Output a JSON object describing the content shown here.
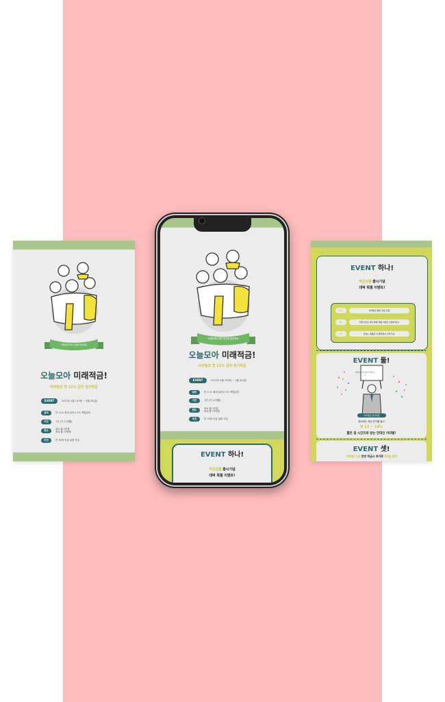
{
  "promo": {
    "banner": "가평안에 더해 가입해 빛내세요",
    "title_teal": "오늘모아",
    "title_dark": "미래적금!",
    "subtitle": "이라벌코 연 11% 금리 정기적금",
    "event_label": "EVENT",
    "event_text": "2023년 4월 15(목) ~ 4월 30(일)",
    "details": [
      {
        "label": "금리",
        "text": "연 11% 최대 금리시 5% 적립금리"
      },
      {
        "label": "기간",
        "text": "1년 (가 12개월)"
      },
      {
        "label": "한도",
        "text": "최소 월 1만원\n최대 월 70만원"
      },
      {
        "label": "조건",
        "text": "연 18세 이상 실명 가입"
      }
    ]
  },
  "event1": {
    "title_teal": "EVENT",
    "title_dark": "하나!",
    "line1_yellow": "적금상품",
    "line1_dark": "출시기념",
    "line2": "대박 특별 이벤트!",
    "items": [
      {
        "label": "하나!",
        "text": "이라벌코 통장 개설 전원"
      },
      {
        "label": "둘!",
        "text": "적금가입한 계좌 특별 경품 이벤트 이용하세요!"
      },
      {
        "label": "셋!",
        "text": "친하는 경품은 내 통장에서 선착가능!"
      }
    ]
  },
  "event2": {
    "title_teal": "EVENT",
    "title_dark": "둘!",
    "sign_text": "이라벌코 정기적금 최대 금리",
    "badge": "이라벌코 정기적금",
    "line1": "최소에는 적금 만기를 들고",
    "rate": "연 12 ~ 14%",
    "line2": "짧은 길 시간으로 받는 만대인 이라벌!"
  },
  "event3": {
    "title_teal": "EVENT",
    "title_dark": "셋!",
    "line_prefix": "70만원 이상",
    "line_dark": "한번 적금시 추가로",
    "line_suffix": "5만원 증정"
  },
  "colors": {
    "teal": "#2e6a6c",
    "lime": "#cfd85a",
    "mint_bar": "#a9c68c",
    "pink_bg": "#febcbc",
    "yellow_text": "#c9c23a"
  }
}
